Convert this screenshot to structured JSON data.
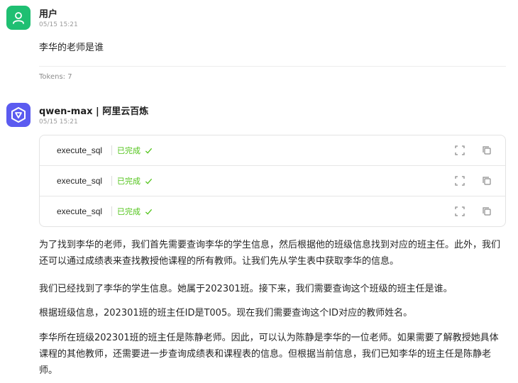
{
  "user": {
    "name": "用户",
    "time": "05/15 15:21",
    "message": "李华的老师是谁",
    "tokens": "Tokens: 7"
  },
  "assistant": {
    "name": "qwen-max | 阿里云百炼",
    "time": "05/15 15:21",
    "tool_calls": [
      {
        "name": "execute_sql",
        "status": "已完成"
      },
      {
        "name": "execute_sql",
        "status": "已完成"
      },
      {
        "name": "execute_sql",
        "status": "已完成"
      }
    ],
    "paragraphs": [
      "为了找到李华的老师，我们首先需要查询李华的学生信息，然后根据他的班级信息找到对应的班主任。此外，我们还可以通过成绩表来查找教授他课程的所有教师。让我们先从学生表中获取李华的信息。",
      "我们已经找到了李华的学生信息。她属于202301班。接下来，我们需要查询这个班级的班主任是谁。",
      "根据班级信息，202301班的班主任ID是T005。现在我们需要查询这个ID对应的教师姓名。",
      "李华所在班级202301班的班主任是陈静老师。因此，可以认为陈静是李华的一位老师。如果需要了解教授她具体课程的其他教师，还需要进一步查询成绩表和课程表的信息。但根据当前信息，我们已知李华的班主任是陈静老师。"
    ]
  },
  "colors": {
    "user_avatar": "#1fbf72",
    "bot_avatar": "#5b5bf0",
    "status_done": "#52c41a"
  },
  "icons": [
    "user-icon",
    "qwen-logo-icon",
    "check-icon",
    "fullscreen-icon",
    "copy-icon"
  ]
}
